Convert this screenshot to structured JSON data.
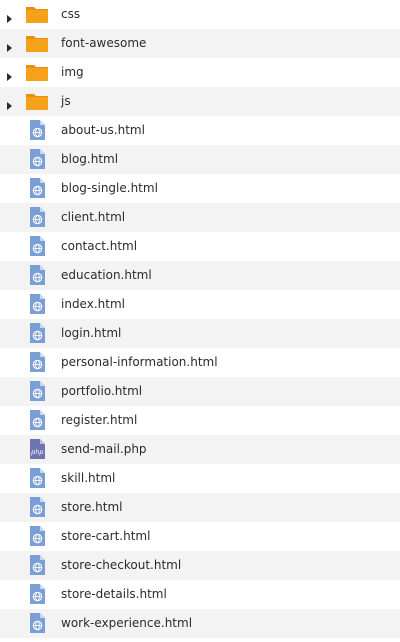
{
  "file_tree": {
    "items": [
      {
        "label": "css",
        "type": "folder",
        "icon": "folder-icon"
      },
      {
        "label": "font-awesome",
        "type": "folder",
        "icon": "folder-icon"
      },
      {
        "label": "img",
        "type": "folder",
        "icon": "folder-icon"
      },
      {
        "label": "js",
        "type": "folder",
        "icon": "folder-icon"
      },
      {
        "label": "about-us.html",
        "type": "html",
        "icon": "html-file-icon"
      },
      {
        "label": "blog.html",
        "type": "html",
        "icon": "html-file-icon"
      },
      {
        "label": "blog-single.html",
        "type": "html",
        "icon": "html-file-icon"
      },
      {
        "label": "client.html",
        "type": "html",
        "icon": "html-file-icon"
      },
      {
        "label": "contact.html",
        "type": "html",
        "icon": "html-file-icon"
      },
      {
        "label": "education.html",
        "type": "html",
        "icon": "html-file-icon"
      },
      {
        "label": "index.html",
        "type": "html",
        "icon": "html-file-icon"
      },
      {
        "label": "login.html",
        "type": "html",
        "icon": "html-file-icon"
      },
      {
        "label": "personal-information.html",
        "type": "html",
        "icon": "html-file-icon"
      },
      {
        "label": "portfolio.html",
        "type": "html",
        "icon": "html-file-icon"
      },
      {
        "label": "register.html",
        "type": "html",
        "icon": "html-file-icon"
      },
      {
        "label": "send-mail.php",
        "type": "php",
        "icon": "php-file-icon"
      },
      {
        "label": "skill.html",
        "type": "html",
        "icon": "html-file-icon"
      },
      {
        "label": "store.html",
        "type": "html",
        "icon": "html-file-icon"
      },
      {
        "label": "store-cart.html",
        "type": "html",
        "icon": "html-file-icon"
      },
      {
        "label": "store-checkout.html",
        "type": "html",
        "icon": "html-file-icon"
      },
      {
        "label": "store-details.html",
        "type": "html",
        "icon": "html-file-icon"
      },
      {
        "label": "work-experience.html",
        "type": "html",
        "icon": "html-file-icon"
      }
    ]
  },
  "colors": {
    "folder": "#f5a21a",
    "folder_tab": "#e8900c",
    "file_page": "#7a9fd6",
    "file_fold": "#c9d8f0",
    "php_page": "#6e74ae",
    "row_alt": "#f3f3f3",
    "text": "#2b2b2b",
    "expander": "#2b2b2b"
  }
}
